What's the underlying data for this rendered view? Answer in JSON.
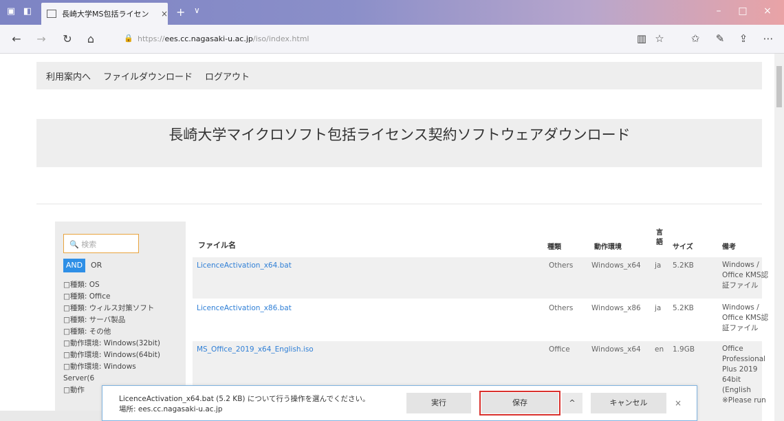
{
  "browser": {
    "tab_title": "長崎大学MS包括ライセン",
    "tab_close": "×",
    "new_tab": "+",
    "tab_menu": "∨",
    "window": {
      "minimize": "–",
      "maximize": "□",
      "close": "×"
    },
    "url_prefix": "https://",
    "url_host": "ees.cc.nagasaki-u.ac.jp",
    "url_path": "/iso/index.html"
  },
  "nav": {
    "items": [
      "利用案内へ",
      "ファイルダウンロード",
      "ログアウト"
    ]
  },
  "hero": {
    "title": "長崎大学マイクロソフト包括ライセンス契約ソフトウェアダウンロード"
  },
  "sidebar": {
    "search_placeholder": "検索",
    "and_label": "AND",
    "or_label": "OR",
    "filters": [
      "□種類: OS",
      "□種類: Office",
      "□種類: ウィルス対策ソフト",
      "□種類: サーバ製品",
      "□種類: その他",
      "□動作環境: Windows(32bit)",
      "□動作環境: Windows(64bit)",
      "□動作環境: Windows",
      "Server(6",
      "□動作"
    ]
  },
  "table": {
    "headers": {
      "filename": "ファイル名",
      "type": "種類",
      "env": "動作環境",
      "lang": "言語",
      "size": "サイズ",
      "note": "備考"
    },
    "rows": [
      {
        "filename": "LicenceActivation_x64.bat",
        "type": "Others",
        "env": "Windows_x64",
        "lang": "ja",
        "size": "5.2KB",
        "note": [
          "Windows /",
          "Office KMS認",
          "証ファイル"
        ]
      },
      {
        "filename": "LicenceActivation_x86.bat",
        "type": "Others",
        "env": "Windows_x86",
        "lang": "ja",
        "size": "5.2KB",
        "note": [
          "Windows /",
          "Office KMS認",
          "証ファイル"
        ]
      },
      {
        "filename": "MS_Office_2019_x64_English.iso",
        "type": "Office",
        "env": "Windows_x64",
        "lang": "en",
        "size": "1.9GB",
        "note": [
          "Office",
          "Professional",
          "Plus 2019",
          "64bit (English",
          "※Please run"
        ]
      }
    ]
  },
  "download_bar": {
    "message": "LicenceActivation_x64.bat (5.2 KB) について行う操作を選んでください。",
    "source": "場所: ees.cc.nagasaki-u.ac.jp",
    "run": "実行",
    "save": "保存",
    "more": "^",
    "cancel": "キャンセル",
    "close": "×"
  }
}
